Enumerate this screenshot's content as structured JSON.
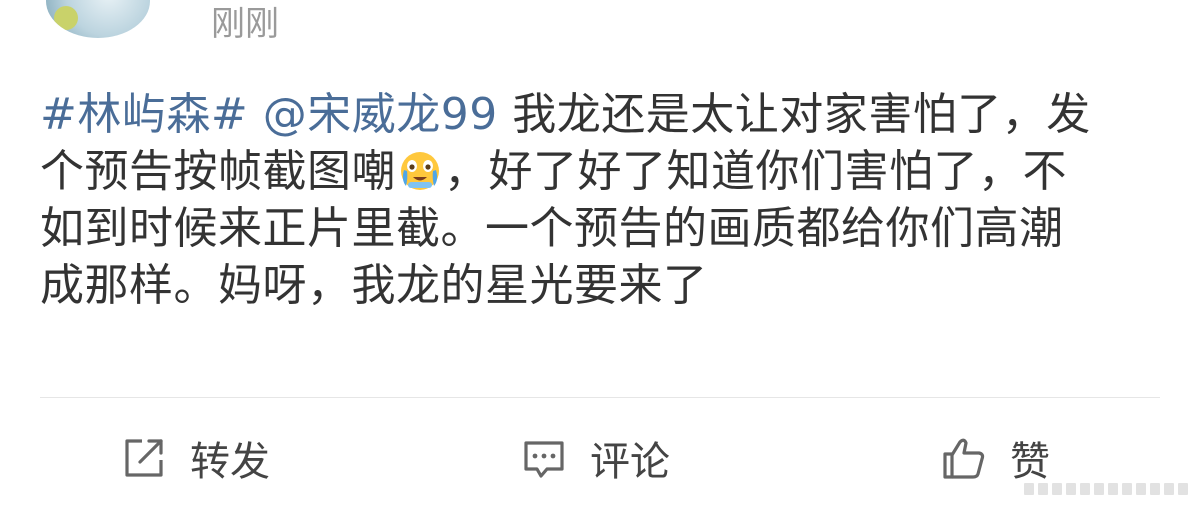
{
  "post": {
    "time": "刚刚",
    "hashtag": "#林屿森#",
    "mention": "@宋威龙99",
    "line1_text": "我龙还是太让对家害怕了，发",
    "line2_before_emoji": "个预告按帧截图嘲",
    "emoji": "crying-laughing-emoji",
    "line2_after_emoji": "，好了好了知道你们害怕了，不",
    "line3": "如到时候来正片里截。一个预告的画质都给你们高潮",
    "line4": "成那样。妈呀，我龙的星光要来了"
  },
  "actions": {
    "repost_label": "转发",
    "comment_label": "评论",
    "like_label": "赞"
  },
  "colors": {
    "link": "#4a6d98",
    "text": "#333333",
    "meta": "#9a9a9a"
  }
}
